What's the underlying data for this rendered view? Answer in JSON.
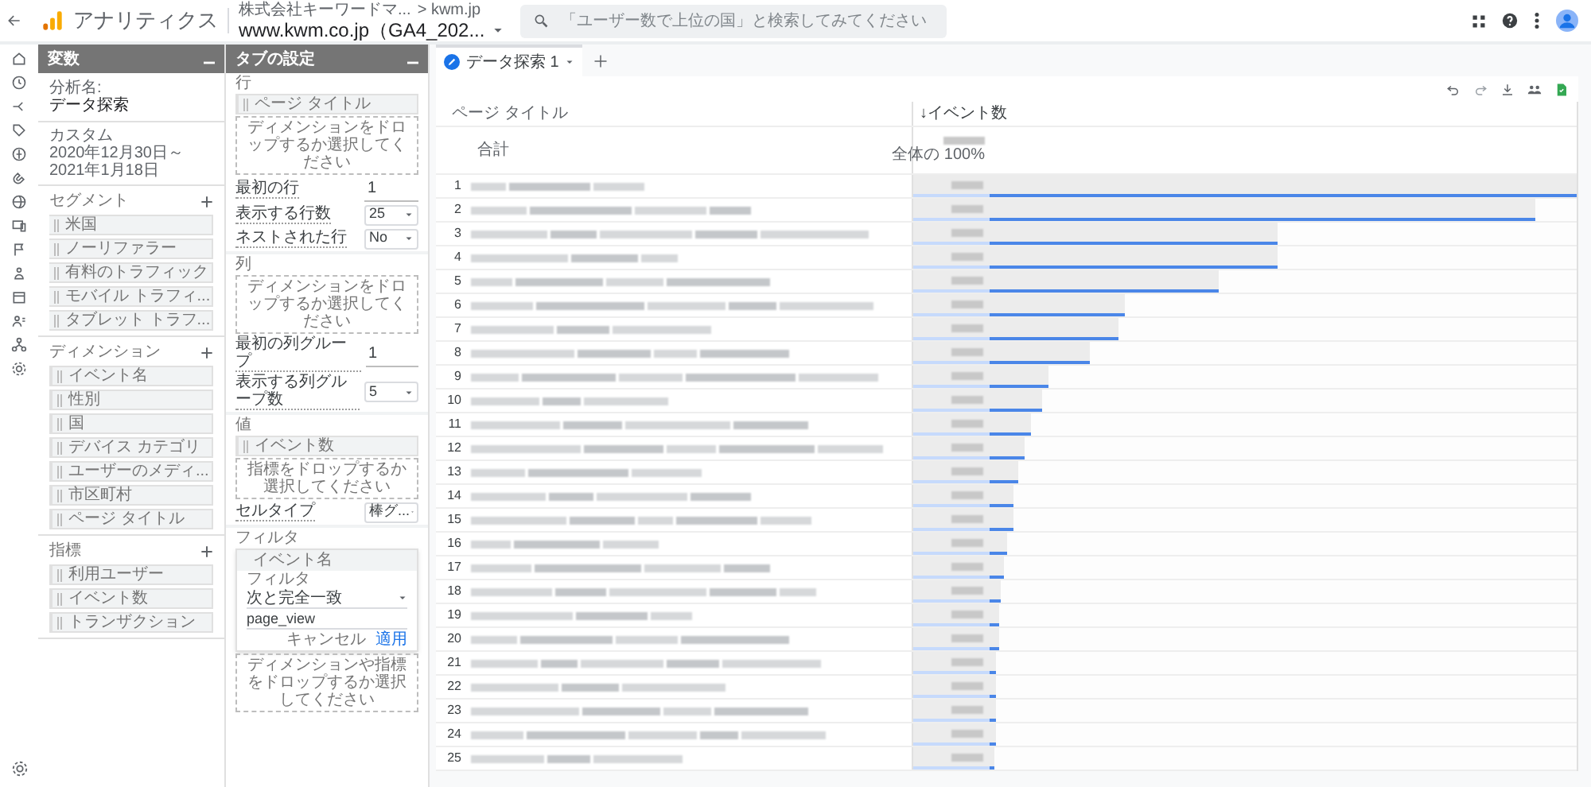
{
  "app": {
    "title": "アナリティクス",
    "account": "株式会社キーワードマ...",
    "crumb": "> kwm.jp",
    "property": "www.kwm.co.jp（GA4_202..."
  },
  "search": {
    "placeholder": "「ユーザー数で上位の国」と検索してみてください"
  },
  "variables_panel": {
    "title": "変数",
    "analysis_label": "分析名:",
    "analysis_name": "データ探索",
    "date_kind": "カスタム",
    "date_range": "2020年12月30日～2021年1月18日",
    "sections": [
      {
        "kind": "segment",
        "title": "セグメント",
        "items": [
          "米国",
          "ノーリファラー",
          "有料のトラフィック",
          "モバイル トラフィ...",
          "タブレット トラフ..."
        ]
      },
      {
        "kind": "dimension",
        "title": "ディメンション",
        "items": [
          "イベント名",
          "性別",
          "国",
          "デバイス カテゴリ",
          "ユーザーのメディ...",
          "市区町村",
          "ページ タイトル"
        ]
      },
      {
        "kind": "metric",
        "title": "指標",
        "items": [
          "利用ユーザー",
          "イベント数",
          "トランザクション"
        ]
      }
    ]
  },
  "settings_panel": {
    "title": "タブの設定",
    "rows": {
      "title": "行",
      "item": "ページ タイトル",
      "drop_hint": "ディメンションをドロップするか選択してください",
      "fields": [
        {
          "label": "最初の行",
          "value": "1",
          "kind": "input"
        },
        {
          "label": "表示する行数",
          "value": "25",
          "kind": "select"
        },
        {
          "label": "ネストされた行",
          "value": "No",
          "kind": "select"
        }
      ]
    },
    "columns": {
      "title": "列",
      "drop_hint": "ディメンションをドロップするか選択してください",
      "fields": [
        {
          "label": "最初の列グループ",
          "value": "1",
          "kind": "input"
        },
        {
          "label": "表示する列グループ数",
          "value": "5",
          "kind": "select"
        }
      ]
    },
    "values": {
      "title": "値",
      "item": "イベント数",
      "drop_hint": "指標をドロップするか選択してください",
      "fields": [
        {
          "label": "セルタイプ",
          "value": "棒グ...",
          "kind": "select"
        }
      ]
    },
    "filters": {
      "title": "フィルタ",
      "dimension": "イベント名",
      "condition_label": "フィルタ",
      "condition": "次と完全一致",
      "value": "page_view",
      "cancel": "キャンセル",
      "apply": "適用",
      "drop_hint": "ディメンションや指標をドロップするか選択してください"
    }
  },
  "tabs": [
    {
      "label": "データ探索 1",
      "selected": true
    }
  ],
  "table": {
    "columns": [
      "ページ タイトル",
      "↓イベント数"
    ],
    "total_label": "合計",
    "total_share": "全体の 100%",
    "rows": [
      {
        "index": "1",
        "level": 1.0
      },
      {
        "index": "2",
        "level": 0.93
      },
      {
        "index": "3",
        "level": 0.49
      },
      {
        "index": "4",
        "level": 0.49
      },
      {
        "index": "5",
        "level": 0.39
      },
      {
        "index": "6",
        "level": 0.23
      },
      {
        "index": "7",
        "level": 0.22
      },
      {
        "index": "8",
        "level": 0.17
      },
      {
        "index": "9",
        "level": 0.1
      },
      {
        "index": "10",
        "level": 0.09
      },
      {
        "index": "11",
        "level": 0.07
      },
      {
        "index": "12",
        "level": 0.06
      },
      {
        "index": "13",
        "level": 0.05
      },
      {
        "index": "14",
        "level": 0.04
      },
      {
        "index": "15",
        "level": 0.04
      },
      {
        "index": "16",
        "level": 0.03
      },
      {
        "index": "17",
        "level": 0.025
      },
      {
        "index": "18",
        "level": 0.02
      },
      {
        "index": "19",
        "level": 0.015
      },
      {
        "index": "20",
        "level": 0.015
      },
      {
        "index": "21",
        "level": 0.012
      },
      {
        "index": "22",
        "level": 0.012
      },
      {
        "index": "23",
        "level": 0.01
      },
      {
        "index": "24",
        "level": 0.01
      },
      {
        "index": "25",
        "level": 0.008
      }
    ]
  }
}
